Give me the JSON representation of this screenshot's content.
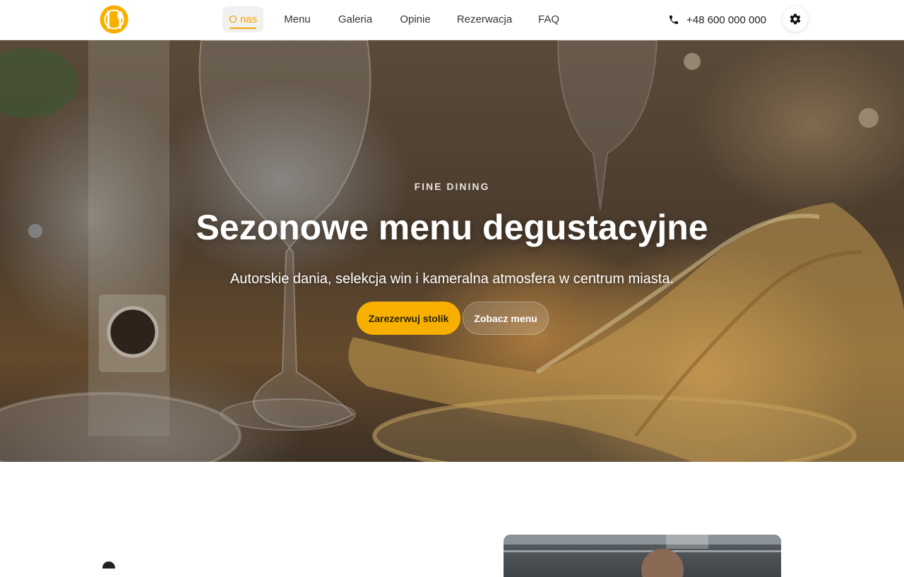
{
  "header": {
    "logo_icon": "fork-spoon-logo-icon",
    "nav": [
      {
        "label": "O nas",
        "active": true
      },
      {
        "label": "Menu",
        "active": false
      },
      {
        "label": "Galeria",
        "active": false
      },
      {
        "label": "Opinie",
        "active": false
      },
      {
        "label": "Rezerwacja",
        "active": false
      },
      {
        "label": "FAQ",
        "active": false
      }
    ],
    "phone_icon": "phone-icon",
    "phone": "+48 600 000 000",
    "settings_icon": "gear-icon"
  },
  "hero": {
    "eyebrow": "FINE DINING",
    "title": "Sezonowe menu degustacyjne",
    "subtitle": "Autorskie dania, selekcja win i kameralna atmosfera w centrum miasta.",
    "primary_button": "Zarezerwuj stolik",
    "secondary_button": "Zobacz menu"
  },
  "colors": {
    "accent": "#f7b000",
    "active_nav": "#f5a400"
  }
}
